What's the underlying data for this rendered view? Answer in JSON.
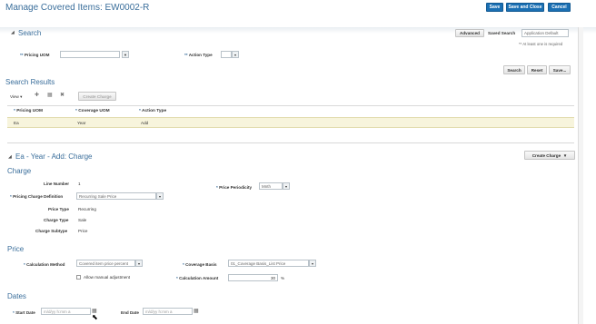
{
  "header": {
    "title": "Manage Covered Items: EW0002-R",
    "save": "Save",
    "save_close": "Save and Close",
    "cancel": "Cancel"
  },
  "search": {
    "title": "Search",
    "advanced": "Advanced",
    "saved_search_label": "Saved Search",
    "saved_search_value": "Application Default",
    "required_note": "** At least one is required",
    "pricing_uom_label": "Pricing UOM",
    "action_type_label": "Action Type",
    "required_mark": "**",
    "search_btn": "Search",
    "reset_btn": "Reset",
    "save_btn": "Save..."
  },
  "results": {
    "title": "Search Results",
    "view_label": "View",
    "create_charge": "Create Charge",
    "columns": [
      "Pricing UOM",
      "Coverage UOM",
      "Action Type"
    ],
    "rows": [
      [
        "Ea",
        "Year",
        "Add"
      ]
    ]
  },
  "charge_section": {
    "title": "Ea - Year - Add: Charge",
    "create_charge_btn": "Create Charge",
    "charge_title": "Charge",
    "line_number_label": "Line Number",
    "line_number_value": "1",
    "price_periodicity_label": "Price Periodicity",
    "price_periodicity_value": "Mnth",
    "pricing_charge_def_label": "Pricing Charge Definition",
    "pricing_charge_def_value": "Recurring Sale Price",
    "price_type_label": "Price Type",
    "price_type_value": "Recurring",
    "charge_type_label": "Charge Type",
    "charge_type_value": "Sale",
    "charge_subtype_label": "Charge Subtype",
    "charge_subtype_value": "Price",
    "required_mark": "*"
  },
  "price": {
    "title": "Price",
    "calc_method_label": "Calculation Method",
    "calc_method_value": "Covered item price percent",
    "coverage_basis_label": "Coverage Basis",
    "coverage_basis_value": "01_Coverage Basis_List Price",
    "allow_manual_label": "Allow manual adjustment",
    "calc_amount_label": "Calculation Amount",
    "calc_amount_value": "30",
    "percent_sign": "%"
  },
  "dates": {
    "title": "Dates",
    "start_label": "Start Date",
    "start_placeholder": "m/d/yy h:mm a",
    "end_label": "End Date",
    "end_placeholder": "m/d/yy h:mm a"
  },
  "colors": {
    "primary_button": "#1a6fb3",
    "heading": "#3a6e9b",
    "selected_row": "#f7f4dc"
  }
}
